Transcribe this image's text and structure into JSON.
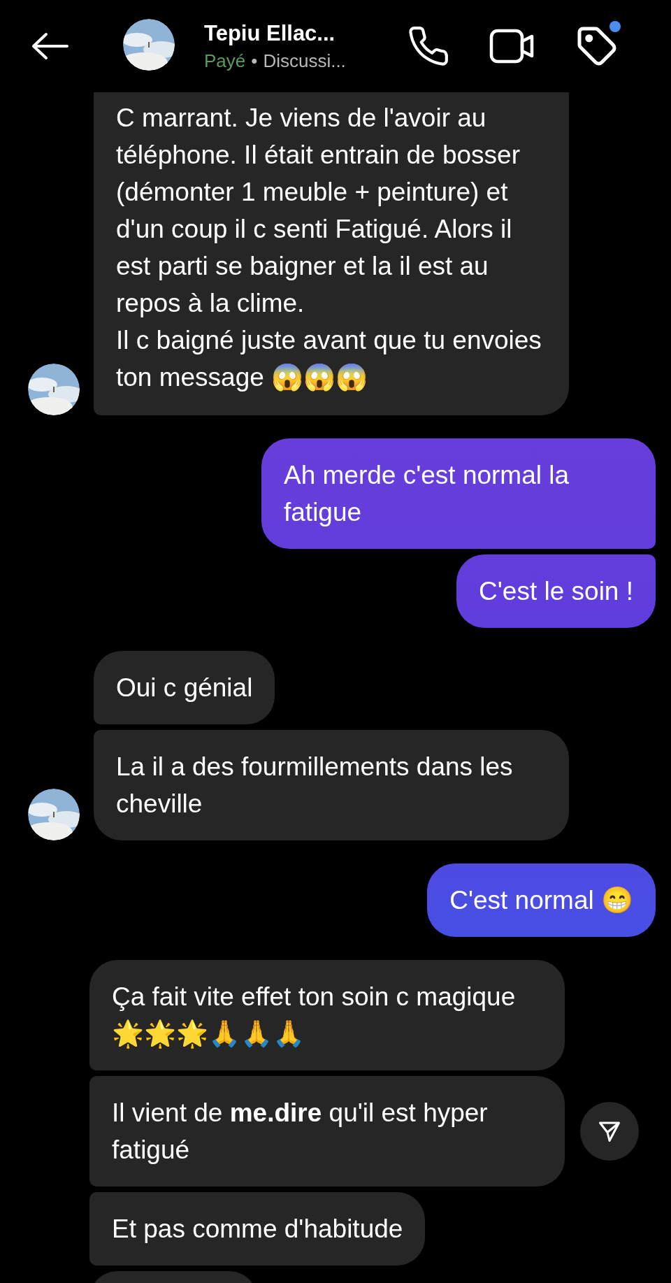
{
  "header": {
    "title": "Tepiu Ellac...",
    "status": "Payé",
    "separator": "•",
    "subtitle": "Discussi...",
    "tag_badge": true
  },
  "groups": [
    {
      "kind": "received",
      "avatar": true,
      "messages": [
        {
          "text": "C marrant. Je viens de l'avoir au téléphone. Il était entrain de bosser (démonter 1 meuble + peinture) et d'un coup il c senti Fatigué. Alors il est parti se baigner et la il est au repos à la clime.\nIl c baigné juste avant que tu envoies ton message 😱😱😱",
          "clipped_top": true,
          "share": false
        }
      ]
    },
    {
      "kind": "sent",
      "avatar": false,
      "messages": [
        {
          "text": "Ah merde c'est normal la fatigue",
          "clipped_top": false,
          "share": false
        },
        {
          "text": "C'est le soin !",
          "clipped_top": false,
          "share": false
        }
      ]
    },
    {
      "kind": "received",
      "avatar": true,
      "messages": [
        {
          "text": "Oui c génial",
          "clipped_top": false,
          "share": false
        },
        {
          "text": "La il a des fourmillements dans les cheville",
          "clipped_top": false,
          "share": false
        }
      ]
    },
    {
      "kind": "sent",
      "avatar": false,
      "messages": [
        {
          "text": "C'est normal 😁",
          "clipped_top": false,
          "share": false
        }
      ]
    },
    {
      "kind": "received",
      "avatar": false,
      "messages": [
        {
          "text": "Ça fait vite effet ton soin c magique 🌟🌟🌟🙏🙏🙏",
          "clipped_top": false,
          "share": false
        },
        {
          "text": "Il vient de **me.dire** qu'il est hyper fatigué",
          "clipped_top": false,
          "share": true
        },
        {
          "text": "Et pas comme d'habitude",
          "clipped_top": false,
          "share": false
        },
        {
          "kind": "clipped"
        }
      ]
    }
  ]
}
